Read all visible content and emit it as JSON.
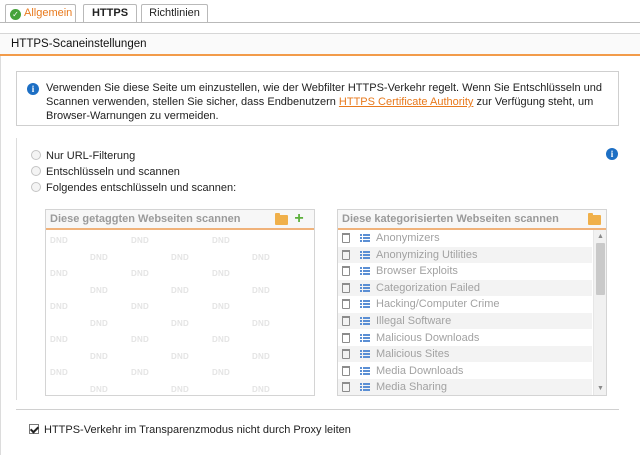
{
  "tabs": [
    {
      "label": "Allgemein"
    },
    {
      "label": "HTTPS"
    },
    {
      "label": "Richtlinien"
    }
  ],
  "section": {
    "title": "HTTPS-Scaneinstellungen"
  },
  "info": {
    "text_before": "Verwenden Sie diese Seite um einzustellen, wie der Webfilter HTTPS-Verkehr regelt. Wenn Sie Entschlüsseln und Scannen verwenden, stellen Sie sicher, dass Endbenutzern ",
    "link": "HTTPS Certificate Authority",
    "text_after": " zur Verfügung steht, um Browser-Warnungen zu vermeiden."
  },
  "options": {
    "radio1": "Nur URL-Filterung",
    "radio2": "Entschlüsseln und scannen",
    "radio3": "Folgendes entschlüsseln und scannen:"
  },
  "left_panel": {
    "title": "Diese getaggten Webseiten scannen",
    "dnd": "DND"
  },
  "right_panel": {
    "title": "Diese kategorisierten Webseiten scannen",
    "items": [
      "Anonymizers",
      "Anonymizing Utilities",
      "Browser Exploits",
      "Categorization Failed",
      "Hacking/Computer Crime",
      "Illegal Software",
      "Malicious Downloads",
      "Malicious Sites",
      "Media Downloads",
      "Media Sharing"
    ]
  },
  "checkbox": {
    "label": "HTTPS-Verkehr im Transparenzmodus nicht durch Proxy leiten",
    "checked": true
  },
  "colors": {
    "accent": "#e8791c",
    "info": "#1d6fc4",
    "ok": "#46a33a"
  }
}
